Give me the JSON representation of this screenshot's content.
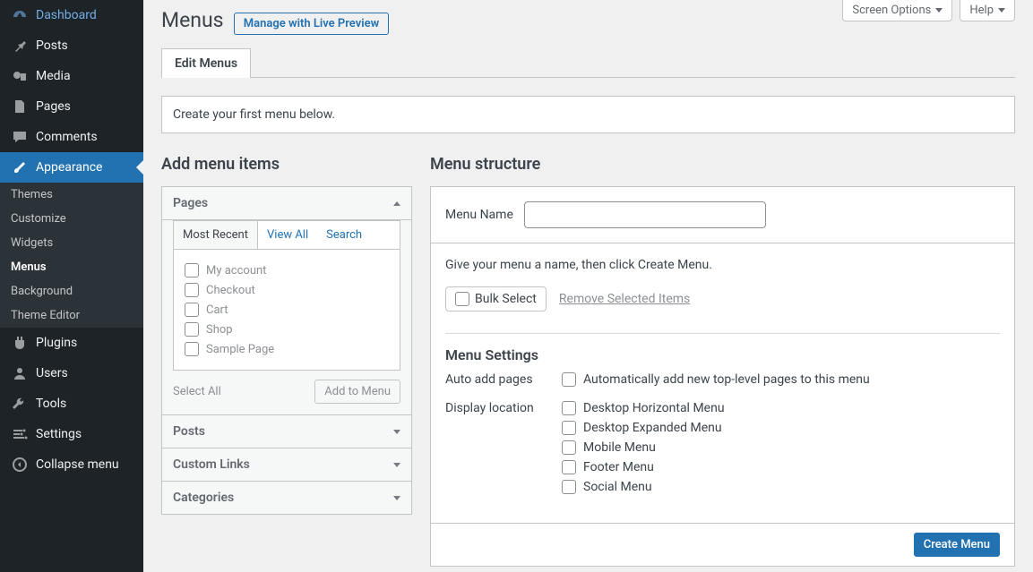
{
  "topbar": {
    "screen_options": "Screen Options",
    "help": "Help"
  },
  "sidebar": {
    "dashboard": "Dashboard",
    "posts": "Posts",
    "media": "Media",
    "pages": "Pages",
    "comments": "Comments",
    "appearance": "Appearance",
    "plugins": "Plugins",
    "users": "Users",
    "tools": "Tools",
    "settings": "Settings",
    "collapse": "Collapse menu",
    "submenu": {
      "themes": "Themes",
      "customize": "Customize",
      "widgets": "Widgets",
      "menus": "Menus",
      "background": "Background",
      "theme_editor": "Theme Editor"
    }
  },
  "page": {
    "title": "Menus",
    "live_preview": "Manage with Live Preview",
    "tab_edit": "Edit Menus",
    "notice": "Create your first menu below."
  },
  "left": {
    "heading": "Add menu items",
    "pages": "Pages",
    "subtabs": {
      "recent": "Most Recent",
      "viewall": "View All",
      "search": "Search"
    },
    "items": [
      "My account",
      "Checkout",
      "Cart",
      "Shop",
      "Sample Page"
    ],
    "select_all": "Select All",
    "add_to_menu": "Add to Menu",
    "posts": "Posts",
    "custom_links": "Custom Links",
    "categories": "Categories"
  },
  "right": {
    "heading": "Menu structure",
    "menu_name_label": "Menu Name",
    "menu_name_value": "",
    "hint": "Give your menu a name, then click Create Menu.",
    "bulk_select": "Bulk Select",
    "remove_selected": "Remove Selected Items",
    "settings_heading": "Menu Settings",
    "auto_add_label": "Auto add pages",
    "auto_add_option": "Automatically add new top-level pages to this menu",
    "display_label": "Display location",
    "locations": [
      "Desktop Horizontal Menu",
      "Desktop Expanded Menu",
      "Mobile Menu",
      "Footer Menu",
      "Social Menu"
    ],
    "create_menu": "Create Menu"
  }
}
